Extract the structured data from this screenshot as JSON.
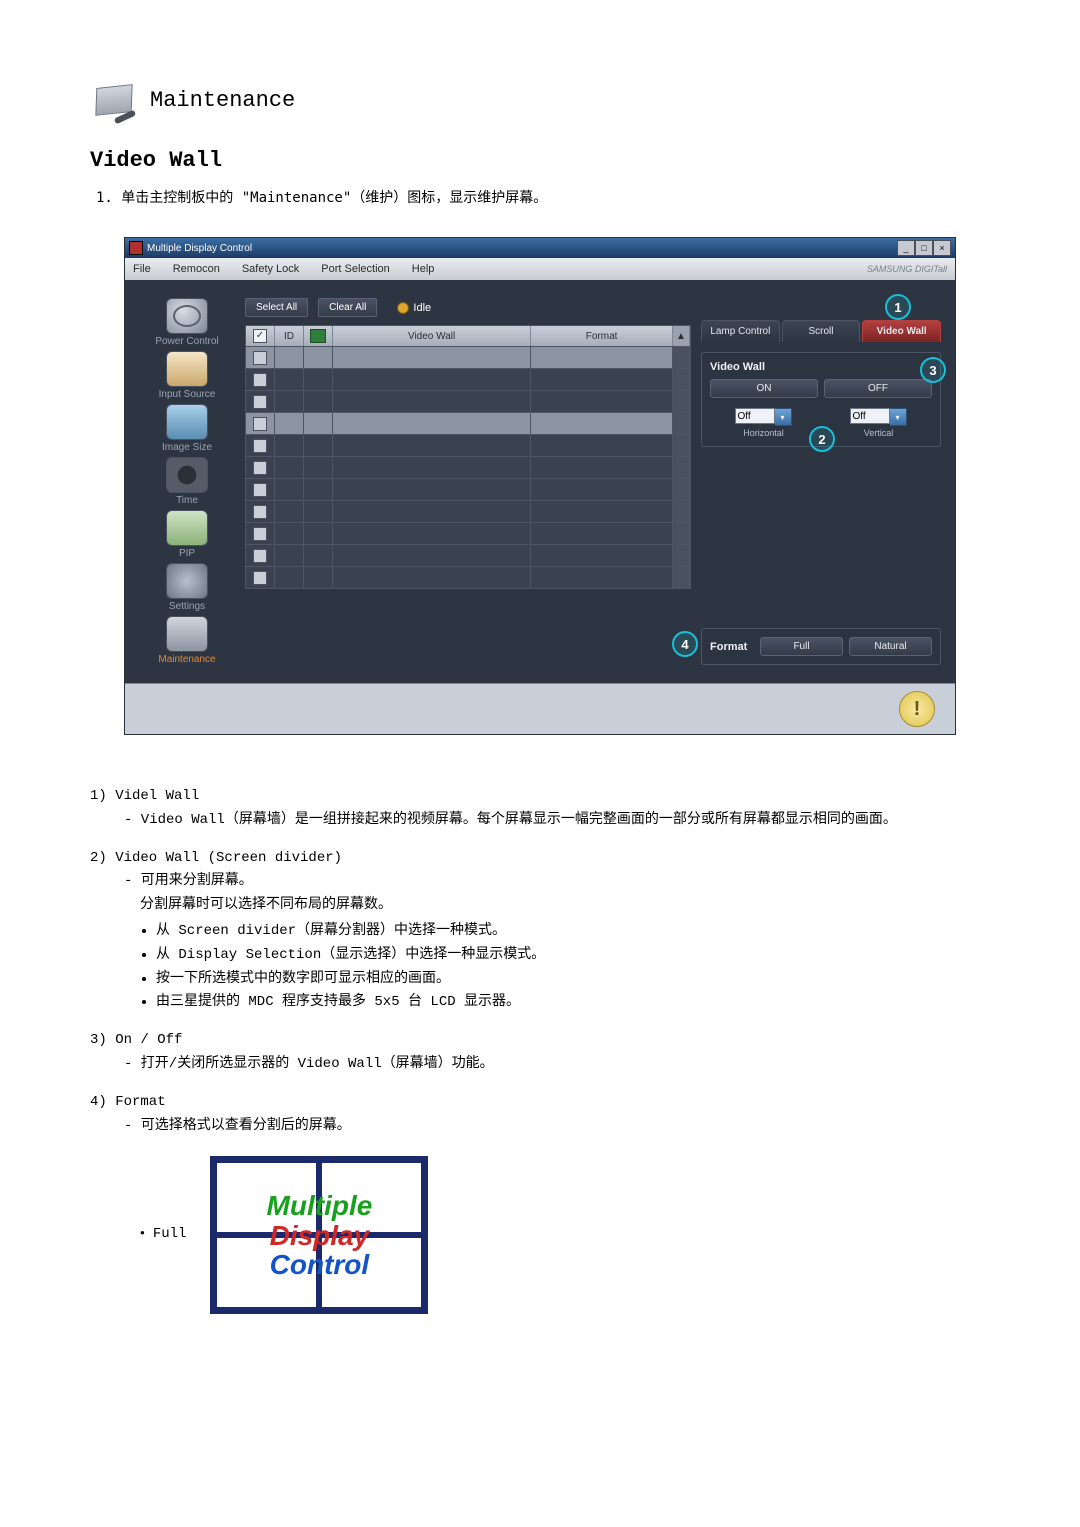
{
  "header": {
    "title": "Maintenance"
  },
  "section_title": "Video Wall",
  "step1": "1. 单击主控制板中的 \"Maintenance\"（维护）图标，显示维护屏幕。",
  "window": {
    "title": "Multiple Display Control",
    "menu": {
      "file": "File",
      "remocon": "Remocon",
      "safety": "Safety Lock",
      "port": "Port Selection",
      "help": "Help"
    },
    "brand": "SAMSUNG DIGITall"
  },
  "sidebar": {
    "power": "Power Control",
    "input": "Input Source",
    "image": "Image Size",
    "time": "Time",
    "pip": "PIP",
    "settings": "Settings",
    "maintenance": "Maintenance"
  },
  "toolbar": {
    "select_all": "Select All",
    "clear_all": "Clear All",
    "status": "Idle"
  },
  "grid": {
    "id": "ID",
    "videowall": "Video Wall",
    "format": "Format"
  },
  "tabs": {
    "lamp": "Lamp Control",
    "scroll": "Scroll",
    "videowall": "Video Wall"
  },
  "vw_panel": {
    "title": "Video Wall",
    "on": "ON",
    "off": "OFF",
    "h_val": "Off",
    "v_val": "Off",
    "h_lab": "Horizontal",
    "v_lab": "Vertical"
  },
  "fmt_panel": {
    "title": "Format",
    "full": "Full",
    "natural": "Natural"
  },
  "markers": {
    "m1": "1",
    "m2": "2",
    "m3": "3",
    "m4": "4"
  },
  "desc": {
    "p1_num": "1) Videl Wall",
    "p1_line": "- Video Wall（屏幕墙）是一组拼接起来的视频屏幕。每个屏幕显示一幅完整画面的一部分或所有屏幕都显示相同的画面。",
    "p2_num": "2) Video Wall (Screen divider)",
    "p2_a": "- 可用来分割屏幕。",
    "p2_b": "分割屏幕时可以选择不同布局的屏幕数。",
    "p2_li1": "从 Screen divider（屏幕分割器）中选择一种模式。",
    "p2_li2": "从 Display Selection（显示选择）中选择一种显示模式。",
    "p2_li3": "按一下所选模式中的数字即可显示相应的画面。",
    "p2_li4": "由三星提供的 MDC 程序支持最多 5x5 台 LCD 显示器。",
    "p3_num": "3) On / Off",
    "p3_line": "- 打开/关闭所选显示器的 Video Wall（屏幕墙）功能。",
    "p4_num": "4) Format",
    "p4_line": "- 可选择格式以查看分割后的屏幕。",
    "full_label": "Full",
    "mdctxt1": "Multiple",
    "mdctxt2": "Display",
    "mdctxt3": "Control"
  }
}
